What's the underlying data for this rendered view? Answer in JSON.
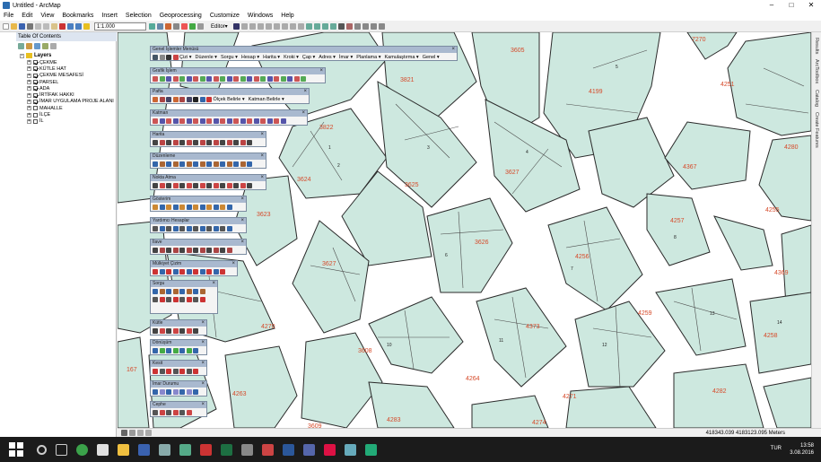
{
  "window": {
    "title": "Untitled - ArcMap"
  },
  "menu": [
    "File",
    "Edit",
    "View",
    "Bookmarks",
    "Insert",
    "Selection",
    "Geoprocessing",
    "Customize",
    "Windows",
    "Help"
  ],
  "toolbar": {
    "scale": "1:1.000",
    "editor_label": "Editor▾"
  },
  "toc": {
    "title": "Table Of Contents",
    "root": "Layers",
    "layers": [
      {
        "name": "ÇEKME",
        "checked": true
      },
      {
        "name": "KÜTLE HAT",
        "checked": true
      },
      {
        "name": "ÇEKME MESAFESİ",
        "checked": true
      },
      {
        "name": "PARSEL",
        "checked": true
      },
      {
        "name": "ADA",
        "checked": true
      },
      {
        "name": "İRTİFAK HAKKI",
        "checked": true
      },
      {
        "name": "İMAR UYGULAMA PROJE ALANI",
        "checked": true
      },
      {
        "name": "MAHALLE",
        "checked": false
      },
      {
        "name": "İLÇE",
        "checked": false
      },
      {
        "name": "İL",
        "checked": false
      }
    ]
  },
  "panels": {
    "genel": {
      "title": "Genel İşlemler Menüsü",
      "menus": [
        "Çizi ▾",
        "Düzenle ▾",
        "Sorgu ▾",
        "Hesap ▾",
        "Harita ▾",
        "Kroki ▾",
        "Çap ▾",
        "Adres ▾",
        "İmar ▾",
        "Planlama ▾",
        "Kamulaştırma ▾",
        "Genel ▾"
      ]
    },
    "grafik": {
      "title": "Grafik İşlem"
    },
    "pafta": {
      "title": "Pafta",
      "menus": [
        "Ölçek Belirle ▾",
        "Katman Belirle ▾"
      ]
    },
    "katman": {
      "title": "Katman"
    },
    "harita": {
      "title": "Harita"
    },
    "duzenleme": {
      "title": "Düzenleme"
    },
    "nokta": {
      "title": "Nokta Atma"
    },
    "gosterim": {
      "title": "Gösterim"
    },
    "yardimci": {
      "title": "Yardımcı Hesaplar"
    },
    "ilave": {
      "title": "İlave"
    },
    "mulkiyet": {
      "title": "Mülkiyet Çizim"
    },
    "sorgu": {
      "title": "Sorgu"
    },
    "kutle": {
      "title": "Kütle"
    },
    "donusum": {
      "title": "Dönüşüm"
    },
    "kesit": {
      "title": "Kesit"
    },
    "imar": {
      "title": "İmar Durumu"
    },
    "cephe": {
      "title": "Cephe"
    }
  },
  "map": {
    "blocks": [
      "7270",
      "3605",
      "4199",
      "4251",
      "3821",
      "3822",
      "4280",
      "3627",
      "3624",
      "3625",
      "4367",
      "3623",
      "3626",
      "4257",
      "4256",
      "4255",
      "4369",
      "4259",
      "3627",
      "4373",
      "4258",
      "3608",
      "4270",
      "4271",
      "4263",
      "4264",
      "4282",
      "4283",
      "4274",
      "167",
      "3609"
    ],
    "parcel_numbers": [
      "1",
      "2",
      "3",
      "4",
      "5",
      "6",
      "7",
      "8",
      "9",
      "10",
      "11",
      "12",
      "13",
      "14"
    ]
  },
  "rightdock": [
    "Results",
    "ArcToolbox",
    "Catalog",
    "Create Features"
  ],
  "status": {
    "coords": "418343.039  4183123.095 Meters"
  },
  "taskbar": {
    "time": "13:58",
    "date": "3.08.2016",
    "lang": "TUR"
  },
  "colors": {
    "parcel": "#cde8df",
    "block_label": "#d64a2a",
    "road": "#ffffff"
  }
}
